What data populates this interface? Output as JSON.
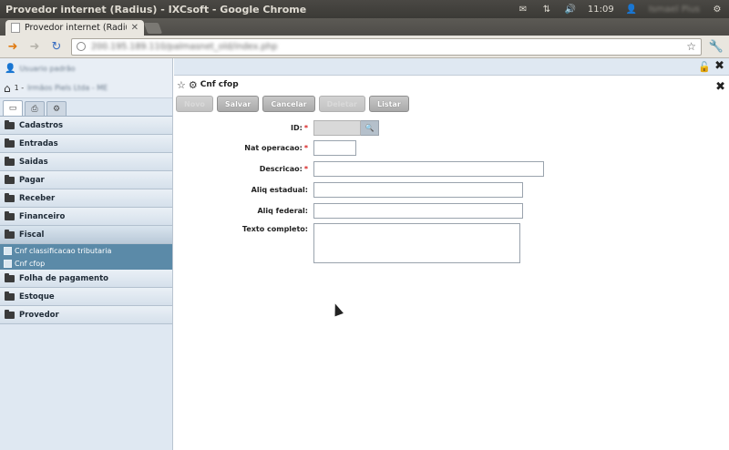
{
  "os_bar": {
    "window_title": "Provedor internet (Radius) - IXCsoft - Google Chrome",
    "clock": "11:09",
    "username": "Ismael Pius"
  },
  "browser": {
    "tab_title": "Provedor internet (Radius",
    "url": "200.195.189.110/palmasnet_old/index.php"
  },
  "sidebar": {
    "user_name": "Usuario padrão",
    "company_number": "1 -",
    "company_name": "Irmãos Piels Ltda - ME",
    "menu": [
      {
        "label": "Cadastros"
      },
      {
        "label": "Entradas"
      },
      {
        "label": "Saidas"
      },
      {
        "label": "Pagar"
      },
      {
        "label": "Receber"
      },
      {
        "label": "Financeiro"
      },
      {
        "label": "Fiscal"
      },
      {
        "label": "Folha de pagamento"
      },
      {
        "label": "Estoque"
      },
      {
        "label": "Provedor"
      }
    ],
    "fiscal_submenu": [
      {
        "label": "Cnf classificacao tributaria"
      },
      {
        "label": "Cnf cfop"
      }
    ]
  },
  "form": {
    "title": "Cnf cfop",
    "buttons": {
      "novo": "Novo",
      "salvar": "Salvar",
      "cancelar": "Cancelar",
      "deletar": "Deletar",
      "listar": "Listar"
    },
    "fields": {
      "id": {
        "label": "ID:",
        "required": "*",
        "value": ""
      },
      "nat_operacao": {
        "label": "Nat operacao:",
        "required": "*",
        "value": ""
      },
      "descricao": {
        "label": "Descricao:",
        "required": "*",
        "value": ""
      },
      "aliq_estadual": {
        "label": "Aliq estadual:",
        "value": ""
      },
      "aliq_federal": {
        "label": "Aliq federal:",
        "value": ""
      },
      "texto_completo": {
        "label": "Texto completo:",
        "value": ""
      }
    }
  }
}
